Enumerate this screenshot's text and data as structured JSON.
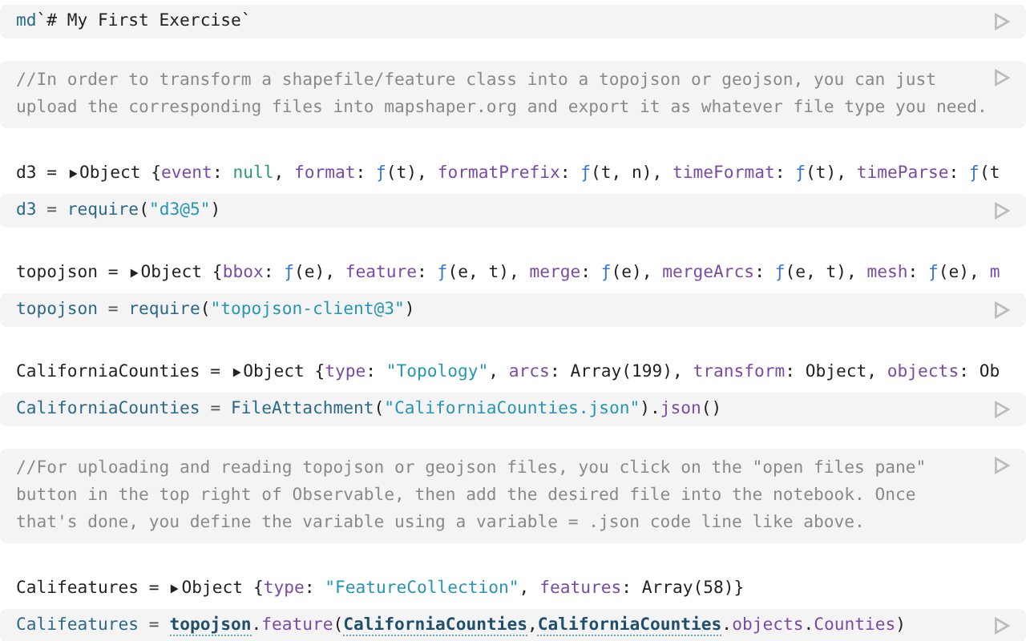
{
  "cells": [
    {
      "kind": "code",
      "source": {
        "lines": [
          [
            {
              "kind": "name",
              "text": "md"
            },
            {
              "kind": "plain",
              "text": "`# My First Exercise`"
            }
          ]
        ]
      }
    },
    {
      "kind": "comment",
      "source": {
        "lines": [
          [
            {
              "kind": "comment",
              "text": "//In order to transform a shapefile/feature class into a topojson or geojson, you can just"
            }
          ],
          [
            {
              "kind": "comment",
              "text": "upload the corresponding files into mapshaper.org and export it as whatever file type you need."
            }
          ]
        ]
      }
    },
    {
      "kind": "code",
      "output": {
        "name": "d3 =",
        "expanded": false,
        "tokens": [
          {
            "kind": "plain",
            "text": "Object {"
          },
          {
            "kind": "prop",
            "text": "event"
          },
          {
            "kind": "plain",
            "text": ": "
          },
          {
            "kind": "null",
            "text": "null"
          },
          {
            "kind": "plain",
            "text": ", "
          },
          {
            "kind": "prop",
            "text": "format"
          },
          {
            "kind": "plain",
            "text": ": "
          },
          {
            "kind": "fn",
            "text": "ƒ"
          },
          {
            "kind": "plain",
            "text": "(t), "
          },
          {
            "kind": "prop",
            "text": "formatPrefix"
          },
          {
            "kind": "plain",
            "text": ": "
          },
          {
            "kind": "fn",
            "text": "ƒ"
          },
          {
            "kind": "plain",
            "text": "(t, n), "
          },
          {
            "kind": "prop",
            "text": "timeFormat"
          },
          {
            "kind": "plain",
            "text": ": "
          },
          {
            "kind": "fn",
            "text": "ƒ"
          },
          {
            "kind": "plain",
            "text": "(t), "
          },
          {
            "kind": "prop",
            "text": "timeParse"
          },
          {
            "kind": "plain",
            "text": ": "
          },
          {
            "kind": "fn",
            "text": "ƒ"
          },
          {
            "kind": "plain",
            "text": "(t"
          }
        ]
      },
      "source": {
        "lines": [
          [
            {
              "kind": "name",
              "text": "d3"
            },
            {
              "kind": "op",
              "text": " = "
            },
            {
              "kind": "name",
              "text": "require"
            },
            {
              "kind": "plain",
              "text": "("
            },
            {
              "kind": "string",
              "text": "\"d3@5\""
            },
            {
              "kind": "plain",
              "text": ")"
            }
          ]
        ]
      }
    },
    {
      "kind": "code",
      "output": {
        "name": "topojson =",
        "expanded": false,
        "tokens": [
          {
            "kind": "plain",
            "text": "Object {"
          },
          {
            "kind": "prop",
            "text": "bbox"
          },
          {
            "kind": "plain",
            "text": ": "
          },
          {
            "kind": "fn",
            "text": "ƒ"
          },
          {
            "kind": "plain",
            "text": "(e), "
          },
          {
            "kind": "prop",
            "text": "feature"
          },
          {
            "kind": "plain",
            "text": ": "
          },
          {
            "kind": "fn",
            "text": "ƒ"
          },
          {
            "kind": "plain",
            "text": "(e, t), "
          },
          {
            "kind": "prop",
            "text": "merge"
          },
          {
            "kind": "plain",
            "text": ": "
          },
          {
            "kind": "fn",
            "text": "ƒ"
          },
          {
            "kind": "plain",
            "text": "(e), "
          },
          {
            "kind": "prop",
            "text": "mergeArcs"
          },
          {
            "kind": "plain",
            "text": ": "
          },
          {
            "kind": "fn",
            "text": "ƒ"
          },
          {
            "kind": "plain",
            "text": "(e, t), "
          },
          {
            "kind": "prop",
            "text": "mesh"
          },
          {
            "kind": "plain",
            "text": ": "
          },
          {
            "kind": "fn",
            "text": "ƒ"
          },
          {
            "kind": "plain",
            "text": "(e), "
          },
          {
            "kind": "prop",
            "text": "m"
          }
        ]
      },
      "source": {
        "lines": [
          [
            {
              "kind": "name",
              "text": "topojson"
            },
            {
              "kind": "op",
              "text": " = "
            },
            {
              "kind": "name",
              "text": "require"
            },
            {
              "kind": "plain",
              "text": "("
            },
            {
              "kind": "string",
              "text": "\"topojson-client@3\""
            },
            {
              "kind": "plain",
              "text": ")"
            }
          ]
        ]
      }
    },
    {
      "kind": "code",
      "output": {
        "name": "CaliforniaCounties =",
        "expanded": false,
        "tokens": [
          {
            "kind": "plain",
            "text": "Object {"
          },
          {
            "kind": "prop",
            "text": "type"
          },
          {
            "kind": "plain",
            "text": ": "
          },
          {
            "kind": "string",
            "text": "\"Topology\""
          },
          {
            "kind": "plain",
            "text": ", "
          },
          {
            "kind": "prop",
            "text": "arcs"
          },
          {
            "kind": "plain",
            "text": ": Array(199), "
          },
          {
            "kind": "prop",
            "text": "transform"
          },
          {
            "kind": "plain",
            "text": ": Object, "
          },
          {
            "kind": "prop",
            "text": "objects"
          },
          {
            "kind": "plain",
            "text": ": Ob"
          }
        ]
      },
      "source": {
        "lines": [
          [
            {
              "kind": "name",
              "text": "CaliforniaCounties"
            },
            {
              "kind": "op",
              "text": " = "
            },
            {
              "kind": "name",
              "text": "FileAttachment"
            },
            {
              "kind": "plain",
              "text": "("
            },
            {
              "kind": "string",
              "text": "\"CaliforniaCounties.json\""
            },
            {
              "kind": "plain",
              "text": ")."
            },
            {
              "kind": "prop",
              "text": "json"
            },
            {
              "kind": "plain",
              "text": "()"
            }
          ]
        ]
      }
    },
    {
      "kind": "comment",
      "source": {
        "lines": [
          [
            {
              "kind": "comment",
              "text": "//For uploading and reading topojson or geojson files, you click on the \"open files pane\""
            }
          ],
          [
            {
              "kind": "comment",
              "text": "button in the top right of Observable, then add the desired file into the notebook. Once"
            }
          ],
          [
            {
              "kind": "comment",
              "text": "that's done, you define the variable using a variable = .json code line like above."
            }
          ]
        ]
      }
    },
    {
      "kind": "code",
      "output": {
        "name": "Califeatures =",
        "expanded": false,
        "tokens": [
          {
            "kind": "plain",
            "text": "Object {"
          },
          {
            "kind": "prop",
            "text": "type"
          },
          {
            "kind": "plain",
            "text": ": "
          },
          {
            "kind": "string",
            "text": "\"FeatureCollection\""
          },
          {
            "kind": "plain",
            "text": ", "
          },
          {
            "kind": "prop",
            "text": "features"
          },
          {
            "kind": "plain",
            "text": ": Array(58)}"
          }
        ]
      },
      "source": {
        "lines": [
          [
            {
              "kind": "name",
              "text": "Califeatures"
            },
            {
              "kind": "op",
              "text": " = "
            },
            {
              "kind": "ref",
              "text": "topojson"
            },
            {
              "kind": "plain",
              "text": "."
            },
            {
              "kind": "prop",
              "text": "feature"
            },
            {
              "kind": "plain",
              "text": "("
            },
            {
              "kind": "ref",
              "text": "CaliforniaCounties"
            },
            {
              "kind": "plain",
              "text": ","
            },
            {
              "kind": "ref",
              "text": "CaliforniaCounties"
            },
            {
              "kind": "plain",
              "text": "."
            },
            {
              "kind": "prop",
              "text": "objects"
            },
            {
              "kind": "plain",
              "text": "."
            },
            {
              "kind": "prop",
              "text": "Counties"
            },
            {
              "kind": "plain",
              "text": ")"
            }
          ]
        ]
      }
    }
  ]
}
